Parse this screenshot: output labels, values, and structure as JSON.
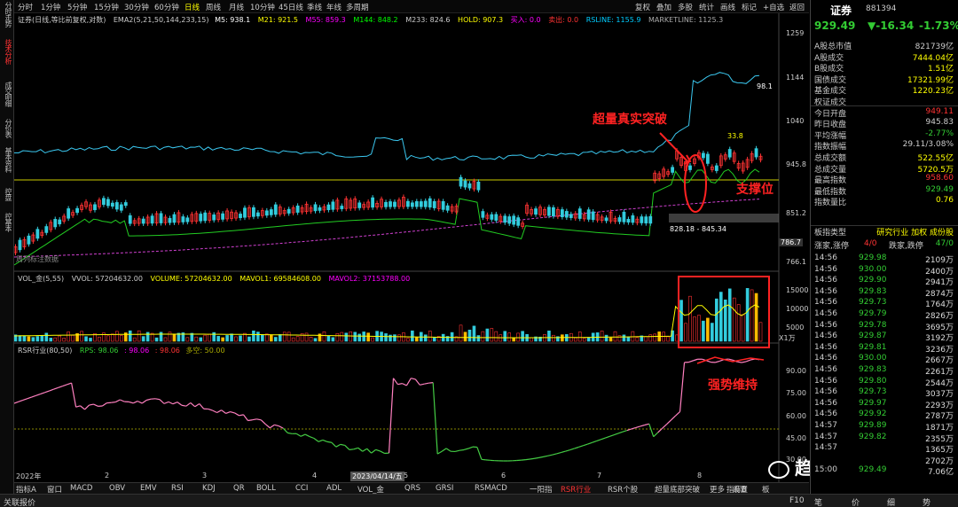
{
  "left_nav": [
    "分时走势",
    "技术分析",
    "成交明细",
    "分价表",
    "基本资料",
    "控盘",
    "控基本"
  ],
  "periods": [
    "分时",
    "1分钟",
    "5分钟",
    "15分钟",
    "30分钟",
    "60分钟",
    "日线",
    "周线",
    "月线",
    "10分钟",
    "45日线",
    "季线",
    "年线",
    "多周期"
  ],
  "active_period": "日线",
  "toolbar": [
    "复权",
    "叠加",
    "多股",
    "统计",
    "画线",
    "标记",
    "+自选",
    "返回"
  ],
  "header": {
    "main_title": "证券(日线,等比前复权,对数)",
    "ema_label": "EMA2(5,21,50,144,233,15)",
    "m5": "M5: 938.1",
    "m21": "M21: 921.5",
    "m55": "M55: 859.3",
    "m144": "M144: 848.2",
    "m233": "M233: 824.6",
    "hold": "HOLD: 907.3",
    "buy": "买入: 0.0",
    "sell": "卖出: 0.0",
    "rsline": "RSLINE: 1155.9",
    "market": "MARKETLINE: 1125.3"
  },
  "main_axis": [
    "1259",
    "1144",
    "1040",
    "945.8",
    "851.2",
    "786.7",
    "766.1"
  ],
  "price_labels": {
    "hi": "98.1",
    "v33": "33.8",
    "range": "828.18 - 845.34",
    "cur": "945.8",
    "low": "786.7"
  },
  "watermark_note": "周列标注数据",
  "annotations": {
    "breakout": "超量真实突破",
    "support": "支撑位",
    "strong": "强势维持"
  },
  "vol": {
    "title": "VOL_金(5,55)",
    "vvol": "VVOL: 57204632.00",
    "volume": "VOLUME: 57204632.00",
    "mavol1": "MAVOL1: 69584608.00",
    "mavol2": "MAVOL2: 37153788.00",
    "axis": [
      "15000",
      "10000",
      "5000"
    ],
    "unit": "X1万"
  },
  "rsr": {
    "title": "RSR行业(80,50)",
    "rps": "RPS: 98.06",
    "v2": ": 98.06",
    "v3": ": 98.06",
    "v4": "多空: 50.00",
    "axis": [
      "90.00",
      "75.00",
      "60.00",
      "45.00",
      "30.00"
    ]
  },
  "x_axis": [
    "2022年",
    "2",
    "3",
    "4",
    "5",
    "6",
    "7",
    "8"
  ],
  "cursor_date": "2023/04/14/五",
  "indicators": [
    "指标A",
    "窗口",
    "MACD",
    "OBV",
    "EMV",
    "RSI",
    "KDJ",
    "QR",
    "BOLL",
    "CCI",
    "ADL",
    "VOL_金",
    "QRS",
    "GRSI",
    "RSMACD",
    "一阳指",
    "RSR行业",
    "RSR个股",
    "超量底部突破",
    "更多",
    "设置"
  ],
  "active_indicator": "RSR行业",
  "btm_right": [
    "指标B",
    "板"
  ],
  "quote": {
    "name": "证券",
    "code": "881394",
    "price": "929.49",
    "chg": "▼-16.34",
    "pct": "-1.73%"
  },
  "stats": [
    [
      "A股总市值",
      "821739亿",
      "#ccc"
    ],
    [
      "A股成交",
      "7444.04亿",
      "#ff0"
    ],
    [
      "B股成交",
      "1.51亿",
      "#ff0"
    ],
    [
      "国债成交",
      "17321.99亿",
      "#ff0"
    ],
    [
      "基金成交",
      "1220.23亿",
      "#ff0"
    ],
    [
      "权证成交",
      "",
      ""
    ],
    [
      "今日开盘",
      "949.11",
      "#f33"
    ],
    [
      "昨日收盘",
      "945.83",
      "#ccc"
    ],
    [
      "平均涨幅",
      "-2.77%",
      "#3c3"
    ],
    [
      "指数振幅",
      "29.11/3.08%",
      "#ccc"
    ],
    [
      "总成交额",
      "522.55亿",
      "#ff0"
    ],
    [
      "总成交量",
      "5720.5万",
      "#ff0"
    ],
    [
      "最高指数",
      "958.60",
      "#f33"
    ],
    [
      "最低指数",
      "929.49",
      "#3c3"
    ],
    [
      "指数量比",
      "0.76",
      "#ff0"
    ]
  ],
  "board": {
    "label": "板指类型",
    "value": "研究行业 加权 成份股",
    "up_label": "涨家,涨停",
    "up": "4/0",
    "dn_label": "跌家,跌停",
    "dn": "47/0"
  },
  "ticks": [
    [
      "14:56",
      "929.98",
      "2109万"
    ],
    [
      "14:56",
      "930.00",
      "2400万"
    ],
    [
      "14:56",
      "929.90",
      "2941万"
    ],
    [
      "14:56",
      "929.83",
      "2874万"
    ],
    [
      "14:56",
      "929.73",
      "1764万"
    ],
    [
      "14:56",
      "929.79",
      "2826万"
    ],
    [
      "14:56",
      "929.78",
      "3695万"
    ],
    [
      "14:56",
      "929.87",
      "3192万"
    ],
    [
      "14:56",
      "929.81",
      "3236万"
    ],
    [
      "14:56",
      "930.00",
      "2667万"
    ],
    [
      "14:56",
      "929.83",
      "2261万"
    ],
    [
      "14:56",
      "929.80",
      "2544万"
    ],
    [
      "14:56",
      "929.73",
      "3037万"
    ],
    [
      "14:56",
      "929.97",
      "2293万"
    ],
    [
      "14:56",
      "929.92",
      "2787万"
    ],
    [
      "14:57",
      "929.89",
      "1871万"
    ],
    [
      "14:57",
      "929.82",
      "2355万"
    ],
    [
      "14:57",
      "",
      "1365万"
    ],
    [
      "",
      "",
      "2702万"
    ],
    [
      "15:00",
      "929.49",
      "7.06亿"
    ]
  ],
  "wechat": "趋势一阳指",
  "status": "关联报价",
  "f10": "F10",
  "bottom_note": "笔",
  "bottom_note2": "价",
  "bottom_note3": "细",
  "bottom_note4": "势"
}
